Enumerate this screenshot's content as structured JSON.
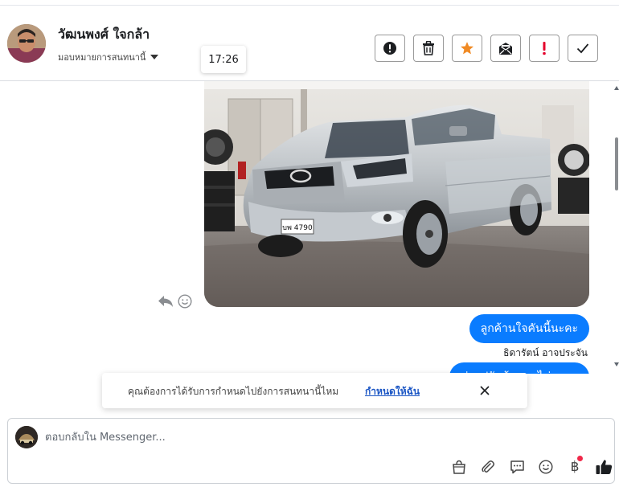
{
  "header": {
    "contact_name": "วัฒนพงศ์ ใจกล้า",
    "assign_label": "มอบหมายการสนทนานี้",
    "tooltip_time": "17:26",
    "actions": [
      {
        "icon": "alert-circle-icon",
        "label": "Mark as spam"
      },
      {
        "icon": "trash-icon",
        "label": "Delete"
      },
      {
        "icon": "star-icon",
        "label": "Star"
      },
      {
        "icon": "mark-unread-icon",
        "label": "Mark as unread"
      },
      {
        "icon": "follow-up-icon",
        "label": "Follow up"
      },
      {
        "icon": "check-icon",
        "label": "Done"
      }
    ]
  },
  "messages": {
    "bubble_1": "ลูกค้านใจคันนี้นะคะ",
    "sender_name": "ธิดารัตน์ อาจประจัน",
    "bubble_2_partial": "ค่ายปรับข้อนผมไม่"
  },
  "photo": {
    "license_plate": "บพ 4790"
  },
  "banner": {
    "text": "คุณต้องการได้รับการกำหนดไปยังการสนทนานี้ไหม",
    "link_label": "กำหนดให้ฉัน"
  },
  "reply": {
    "placeholder": "ตอบกลับใน Messenger..."
  },
  "toolbar_icons": [
    "shop-bag-icon",
    "paperclip-icon",
    "saved-reply-icon",
    "emoji-icon",
    "baht-icon",
    "thumbs-up-icon"
  ],
  "colors": {
    "accent_blue": "#0a7cff",
    "star_orange": "#f08a24",
    "follow_up_red": "#e4002b",
    "notify_dot": "#f02849"
  }
}
